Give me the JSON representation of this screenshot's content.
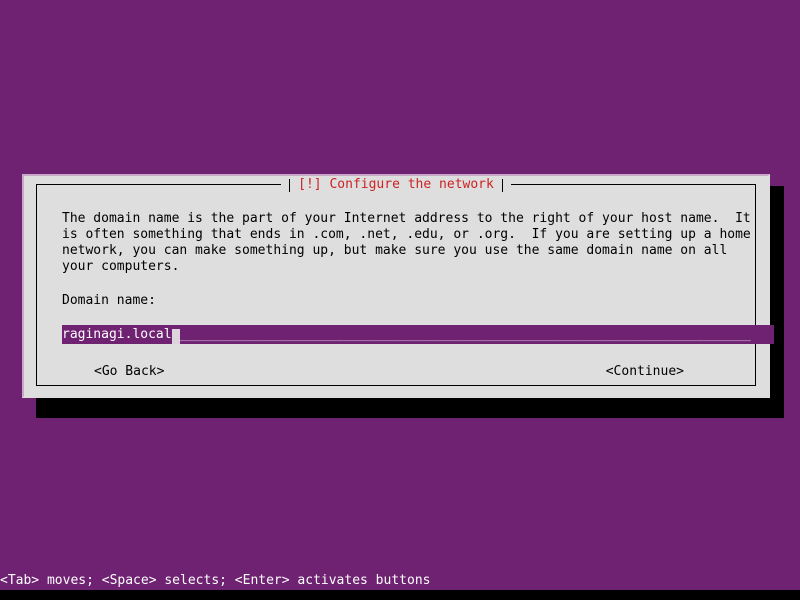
{
  "screen": {
    "background_color": "#6f2271",
    "foreground_color": "#ffffff"
  },
  "dialog": {
    "title": "[!] Configure the network",
    "title_color": "#cc2222",
    "background_color": "#dedede",
    "body_text": "The domain name is the part of your Internet address to the right of your host name.  It\nis often something that ends in .com, .net, .edu, or .org.  If you are setting up a home\nnetwork, you can make something up, but make sure you use the same domain name on all\nyour computers.",
    "field_label": "Domain name:",
    "input": {
      "value": "raginagi.local",
      "placeholder": "",
      "cursor": "_",
      "trailing_fill": "_________________________________________________________________________",
      "background_color": "#6f2271",
      "text_color": "#ffffff"
    },
    "buttons": {
      "go_back": "<Go Back>",
      "continue": "<Continue>"
    }
  },
  "help_bar": {
    "text": "<Tab> moves; <Space> selects; <Enter> activates buttons"
  }
}
